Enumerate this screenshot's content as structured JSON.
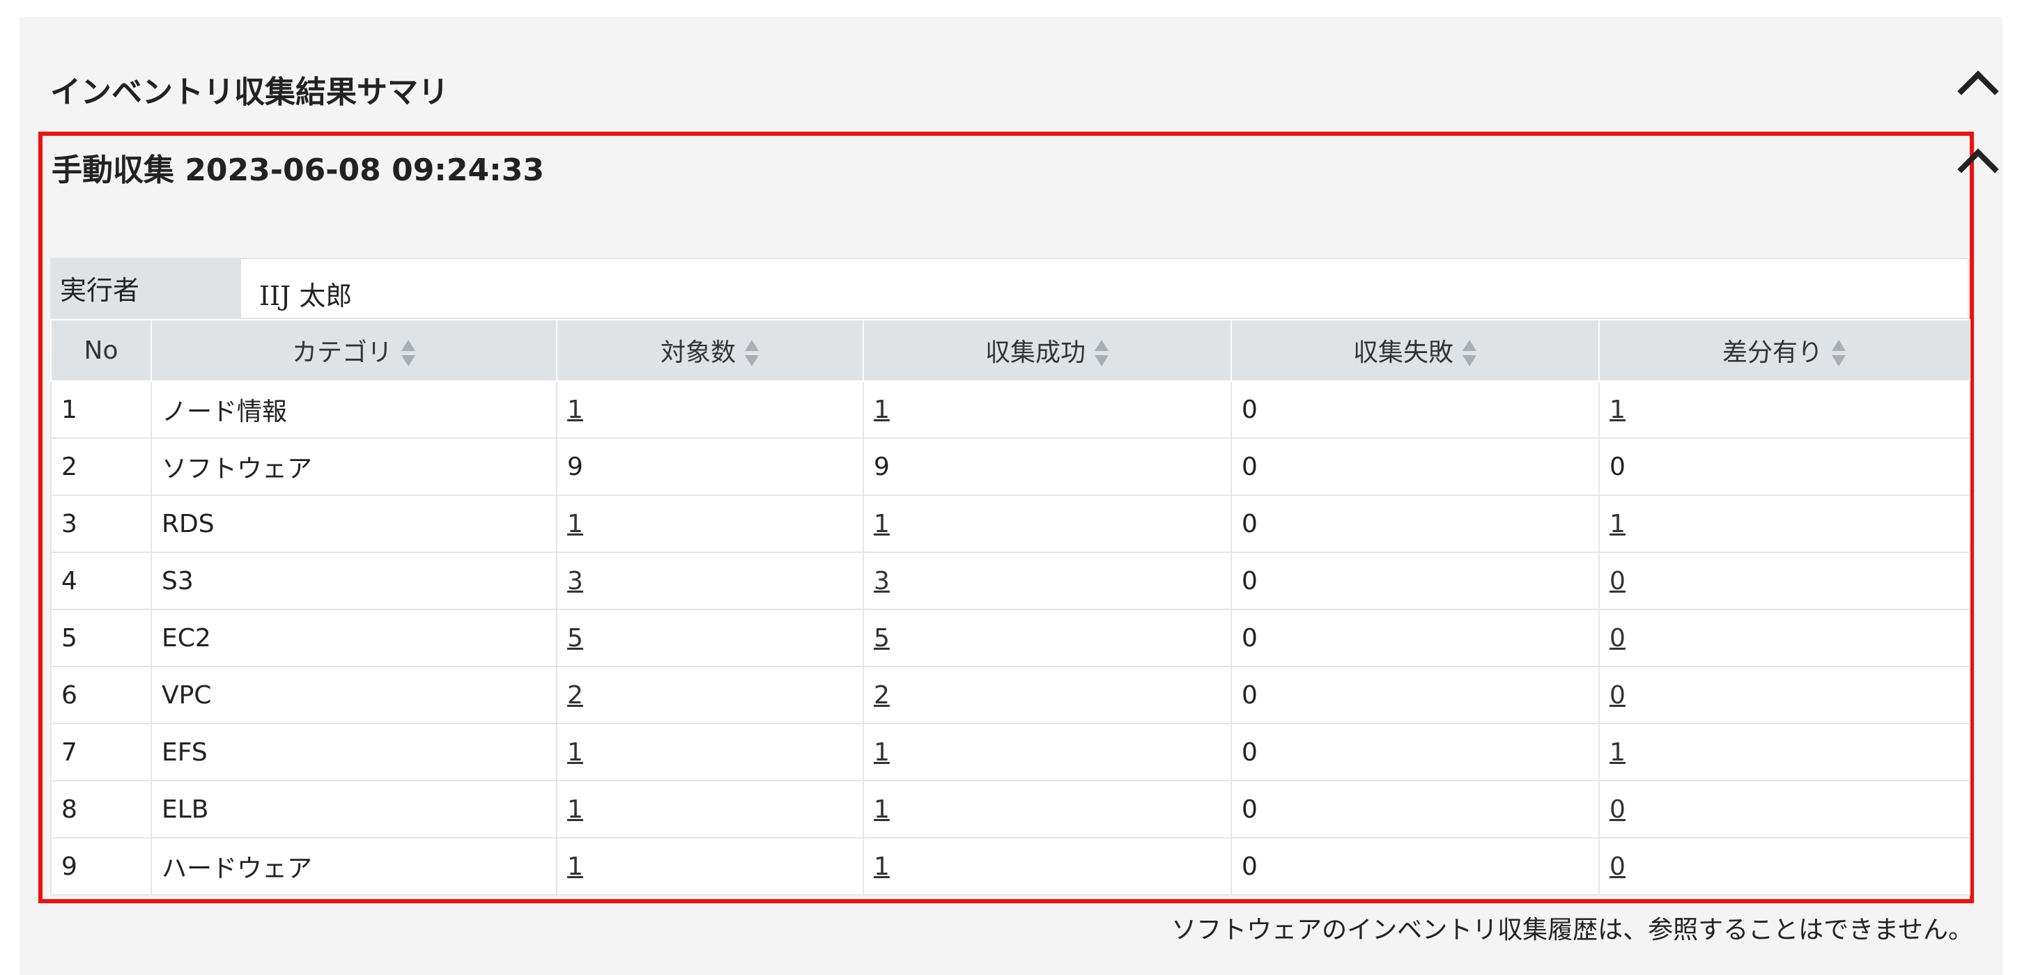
{
  "panel": {
    "title": "インベントリ収集結果サマリ",
    "collapse_icon": "chevron-up-icon"
  },
  "collection": {
    "title": "手動収集 2023-06-08 09:24:33",
    "collapse_icon": "chevron-up-icon",
    "executor_label": "実行者",
    "executor_value": "IIJ 太郎",
    "highlight_color": "#ee1111"
  },
  "table": {
    "columns": [
      {
        "label": "No",
        "sortable": false
      },
      {
        "label": "カテゴリ",
        "sortable": true
      },
      {
        "label": "対象数",
        "sortable": true
      },
      {
        "label": "収集成功",
        "sortable": true
      },
      {
        "label": "収集失敗",
        "sortable": true
      },
      {
        "label": "差分有り",
        "sortable": true
      }
    ],
    "rows": [
      {
        "no": "1",
        "category": "ノード情報",
        "target": "1",
        "success": "1",
        "failure": "0",
        "diff": "1"
      },
      {
        "no": "2",
        "category": "ソフトウェア",
        "target": "9",
        "success": "9",
        "failure": "0",
        "diff": "0"
      },
      {
        "no": "3",
        "category": "RDS",
        "target": "1",
        "success": "1",
        "failure": "0",
        "diff": "1"
      },
      {
        "no": "4",
        "category": "S3",
        "target": "3",
        "success": "3",
        "failure": "0",
        "diff": "0"
      },
      {
        "no": "5",
        "category": "EC2",
        "target": "5",
        "success": "5",
        "failure": "0",
        "diff": "0"
      },
      {
        "no": "6",
        "category": "VPC",
        "target": "2",
        "success": "2",
        "failure": "0",
        "diff": "0"
      },
      {
        "no": "7",
        "category": "EFS",
        "target": "1",
        "success": "1",
        "failure": "0",
        "diff": "1"
      },
      {
        "no": "8",
        "category": "ELB",
        "target": "1",
        "success": "1",
        "failure": "0",
        "diff": "0"
      },
      {
        "no": "9",
        "category": "ハードウェア",
        "target": "1",
        "success": "1",
        "failure": "0",
        "diff": "0"
      }
    ],
    "link_cells": [
      [
        false,
        false,
        true,
        true,
        false,
        true
      ],
      [
        false,
        false,
        false,
        false,
        false,
        false
      ],
      [
        false,
        false,
        true,
        true,
        false,
        true
      ],
      [
        false,
        false,
        true,
        true,
        false,
        true
      ],
      [
        false,
        false,
        true,
        true,
        false,
        true
      ],
      [
        false,
        false,
        true,
        true,
        false,
        true
      ],
      [
        false,
        false,
        true,
        true,
        false,
        true
      ],
      [
        false,
        false,
        true,
        true,
        false,
        true
      ],
      [
        false,
        false,
        true,
        true,
        false,
        true
      ]
    ],
    "sort_icon": "sort-arrows-icon"
  },
  "footnote": "ソフトウェアのインベントリ収集履歴は、参照することはできません。"
}
